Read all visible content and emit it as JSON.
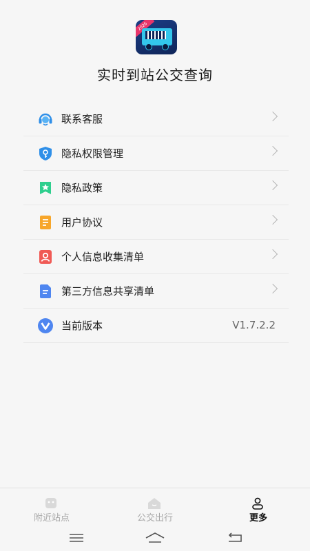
{
  "header": {
    "app_title": "实时到站公交查询",
    "logo_badge_text": "2026"
  },
  "menu": {
    "items": [
      {
        "label": "联系客服",
        "icon": "headset-icon",
        "color": "#2f8fe8"
      },
      {
        "label": "隐私权限管理",
        "icon": "shield-key-icon",
        "color": "#2f8fe8"
      },
      {
        "label": "隐私政策",
        "icon": "bookmark-star-icon",
        "color": "#2fcf8e"
      },
      {
        "label": "用户协议",
        "icon": "document-icon",
        "color": "#f7a62a"
      },
      {
        "label": "个人信息收集清单",
        "icon": "person-card-icon",
        "color": "#f05a55"
      },
      {
        "label": "第三方信息共享清单",
        "icon": "file-list-icon",
        "color": "#4f86f0"
      },
      {
        "label": "当前版本",
        "icon": "version-v-icon",
        "color": "#4f86f0",
        "value": "V1.7.2.2"
      }
    ]
  },
  "tabbar": {
    "tabs": [
      {
        "label": "附近站点",
        "icon": "nearby-stop-icon",
        "active": false
      },
      {
        "label": "公交出行",
        "icon": "bus-travel-icon",
        "active": false
      },
      {
        "label": "更多",
        "icon": "person-icon",
        "active": true
      }
    ]
  },
  "system_nav": {
    "buttons": [
      "menu-icon",
      "home-icon",
      "back-icon"
    ]
  }
}
